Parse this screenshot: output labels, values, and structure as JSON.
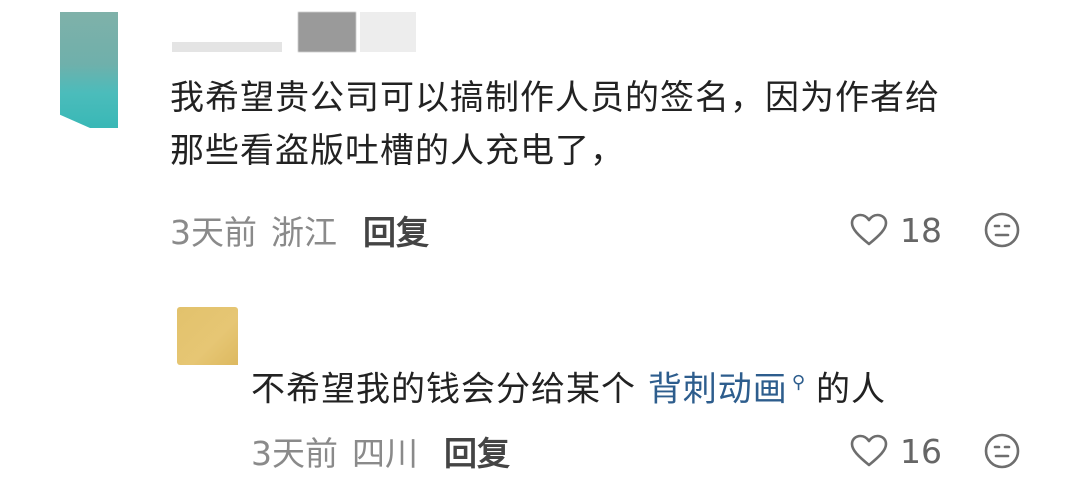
{
  "comments": [
    {
      "text_line1": "我希望贵公司可以搞制作人员的签名，因为作者给",
      "text_line2": "那些看盗版吐槽的人充电了，",
      "time": "3天前",
      "location": "浙江",
      "reply_label": "回复",
      "likes": "18"
    },
    {
      "text_prefix": "不希望我的钱会分给某个 ",
      "link_text": "背刺动画",
      "link_icon": "search-icon",
      "text_suffix": "的人",
      "time": "3天前",
      "location": "四川",
      "reply_label": "回复",
      "likes": "16"
    }
  ],
  "colors": {
    "link": "#2d5d8d",
    "meta": "#8a8a8a",
    "avatar1": "#4bbcbb",
    "avatar2": "#e2c26c"
  }
}
